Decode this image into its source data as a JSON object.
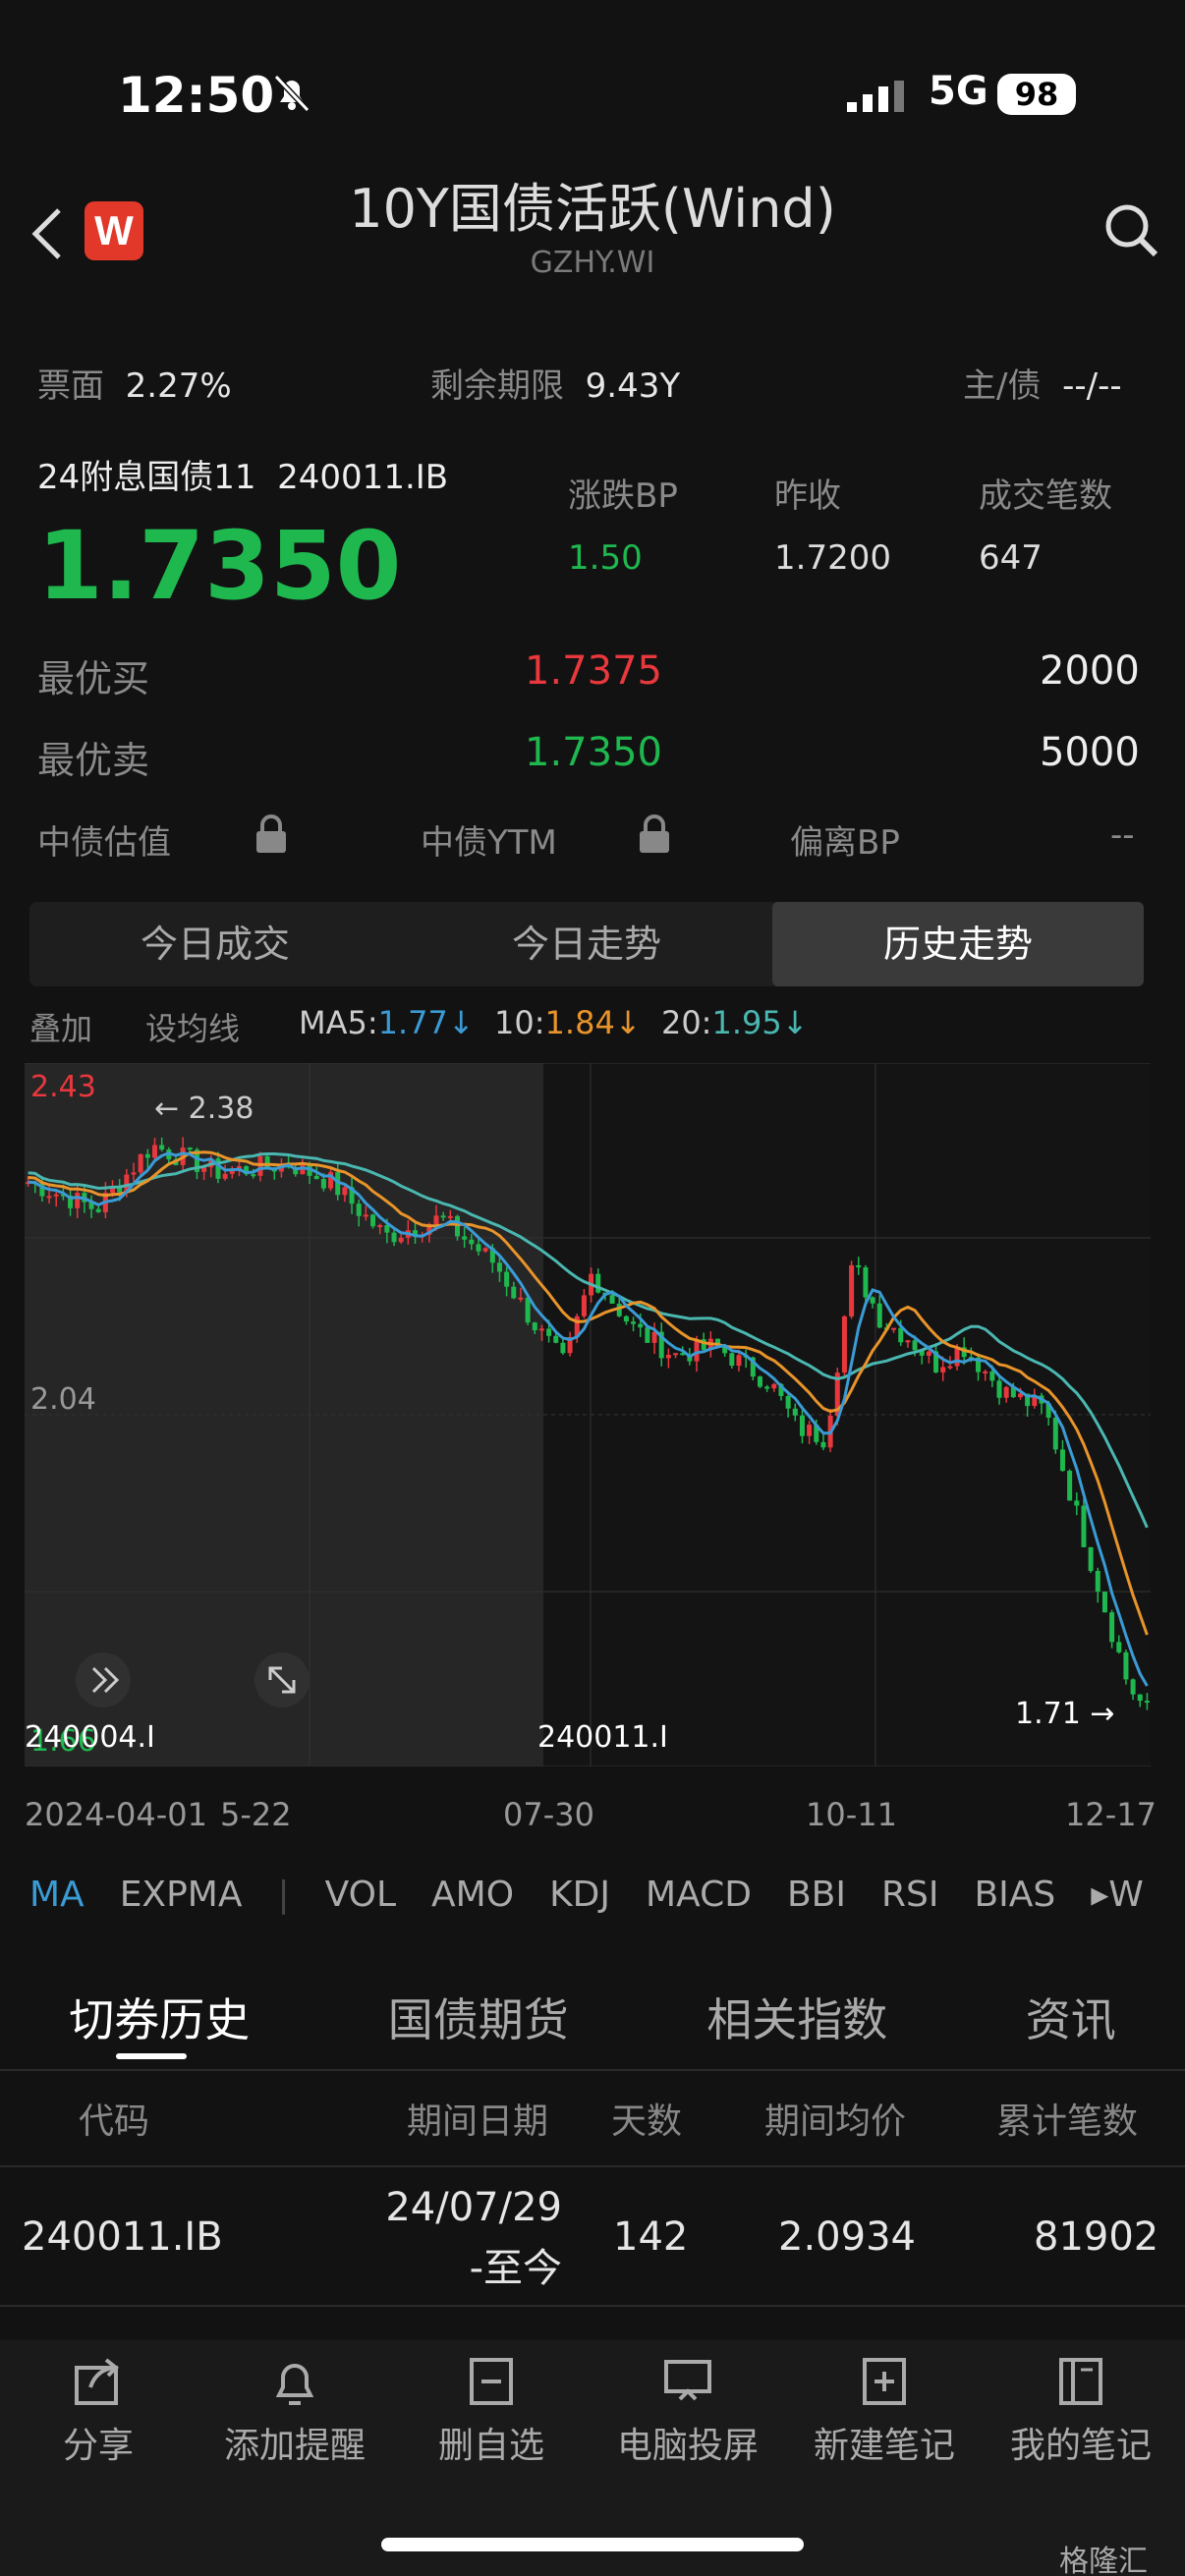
{
  "status": {
    "time": "12:50",
    "network": "5G",
    "battery": "98"
  },
  "header": {
    "title": "10Y国债活跃(Wind)",
    "subtitle": "GZHY.WI",
    "logo": "W"
  },
  "info": {
    "coupon_label": "票面",
    "coupon_value": "2.27%",
    "term_label": "剩余期限",
    "term_value": "9.43Y",
    "rating_label": "主/债",
    "rating_value": "--/--"
  },
  "bond": {
    "name": "24附息国债11",
    "code": "240011.IB",
    "price": "1.7350",
    "change_label": "涨跌BP",
    "change_value": "1.50",
    "prev_label": "昨收",
    "prev_value": "1.7200",
    "trades_label": "成交笔数",
    "trades_value": "647"
  },
  "quotes": {
    "bid_label": "最优买",
    "bid_price": "1.7375",
    "bid_vol": "2000",
    "ask_label": "最优卖",
    "ask_price": "1.7350",
    "ask_vol": "5000"
  },
  "valuation": {
    "v1": "中债估值",
    "v2": "中债YTM",
    "v3": "偏离BP",
    "v3_value": "--"
  },
  "tabs": [
    "今日成交",
    "今日走势",
    "历史走势"
  ],
  "ma": {
    "overlay": "叠加",
    "setting": "设均线",
    "ma5_label": "MA5:",
    "ma5_value": "1.77↓",
    "ma10_label": "10:",
    "ma10_value": "1.84↓",
    "ma20_label": "20:",
    "ma20_value": "1.95↓"
  },
  "chart_labels": {
    "max": "2.43",
    "mid": "2.04",
    "min": "1.66",
    "hi_marker": "← 2.38",
    "lo_marker": "1.71 →",
    "code_left": "240004.I",
    "code_right": "240011.I"
  },
  "dates": [
    "2024-04-01",
    "5-22",
    "07-30",
    "10-11",
    "12-17"
  ],
  "indicators": [
    "MA",
    "EXPMA",
    "VOL",
    "AMO",
    "KDJ",
    "MACD",
    "BBI",
    "RSI",
    "BIAS",
    "▸W"
  ],
  "sub_tabs": [
    "切券历史",
    "国债期货",
    "相关指数",
    "资讯"
  ],
  "table": {
    "headers": [
      "代码",
      "期间日期",
      "天数",
      "期间均价",
      "累计笔数"
    ],
    "rows": [
      {
        "code": "240011.IB",
        "date1": "24/07/29",
        "date2": "-至今",
        "days": "142",
        "avg": "2.0934",
        "count": "81902"
      }
    ]
  },
  "bottom_bar": [
    "分享",
    "添加提醒",
    "删自选",
    "电脑投屏",
    "新建笔记",
    "我的笔记"
  ],
  "watermark": "格隆汇",
  "colors": {
    "up": "#e8383d",
    "down": "#1fb84f",
    "ma5": "#3a9bd5",
    "ma10": "#e8942a",
    "ma20": "#4ab7b0"
  }
}
